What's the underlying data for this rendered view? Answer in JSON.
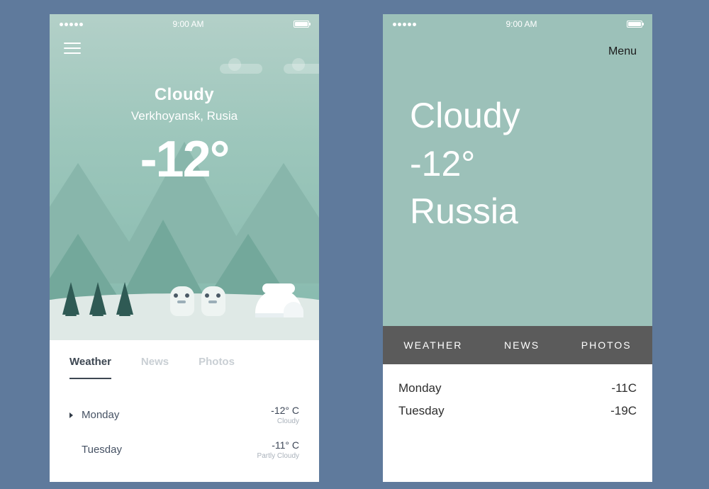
{
  "status": {
    "time": "9:00 AM"
  },
  "phone_a": {
    "hero": {
      "condition": "Cloudy",
      "location": "Verkhoyansk, Rusia",
      "temperature": "-12°"
    },
    "tabs": {
      "weather": "Weather",
      "news": "News",
      "photos": "Photos"
    },
    "days": [
      {
        "name": "Monday",
        "temp": "-12° C",
        "cond": "Cloudy"
      },
      {
        "name": "Tuesday",
        "temp": "-11° C",
        "cond": "Partly Cloudy"
      }
    ]
  },
  "phone_b": {
    "menu_label": "Menu",
    "hero": {
      "condition": "Cloudy",
      "temperature": "-12°",
      "location": "Russia"
    },
    "tabs": {
      "weather": "WEATHER",
      "news": "NEWS",
      "photos": "PHOTOS"
    },
    "days": [
      {
        "name": "Monday",
        "temp": "-11C"
      },
      {
        "name": "Tuesday",
        "temp": "-19C"
      }
    ]
  }
}
